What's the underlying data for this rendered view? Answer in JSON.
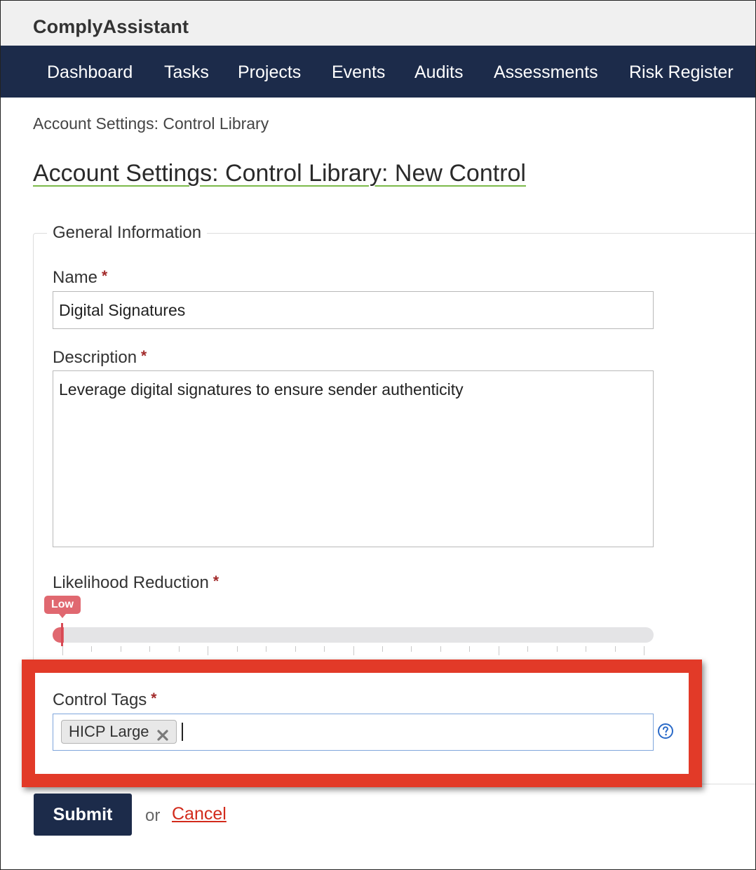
{
  "app": {
    "title": "ComplyAssistant"
  },
  "nav": {
    "items": [
      "Dashboard",
      "Tasks",
      "Projects",
      "Events",
      "Audits",
      "Assessments",
      "Risk Register"
    ]
  },
  "breadcrumb": "Account Settings: Control Library",
  "page_title": "Account Settings: Control Library: New Control",
  "form": {
    "legend": "General Information",
    "required_marker": "*",
    "name": {
      "label": "Name",
      "value": "Digital Signatures"
    },
    "description": {
      "label": "Description",
      "value": "Leverage digital signatures to ensure sender authenticity"
    },
    "likelihood_reduction": {
      "label": "Likelihood Reduction",
      "value_label": "Low",
      "position_fraction": 0.0
    },
    "control_tags": {
      "label": "Control Tags",
      "tags": [
        "HICP Large"
      ]
    },
    "submit_label": "Submit",
    "or_text": "or",
    "cancel_label": "Cancel"
  },
  "colors": {
    "nav_bg": "#1c2b4a",
    "highlight_border": "#e23a28",
    "slider_fill": "#e06870",
    "required": "#a22a2a",
    "cancel_link": "#d22b1c",
    "title_underline": "#7cba4a"
  },
  "icons": {
    "tag_remove": "close-icon",
    "help": "question-circle-icon"
  }
}
